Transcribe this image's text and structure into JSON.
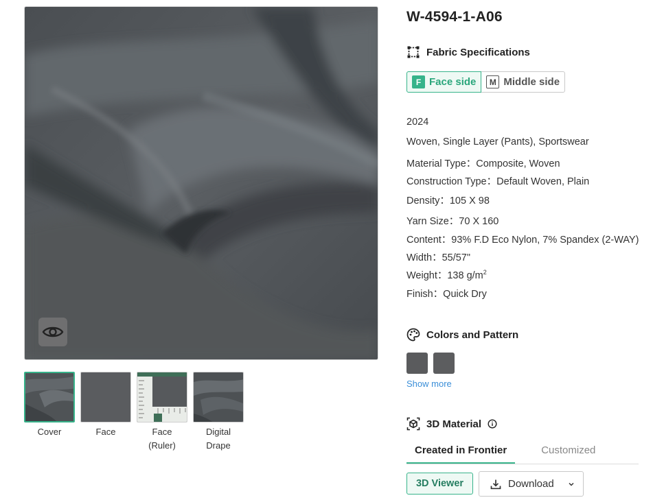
{
  "product": {
    "code": "W-4594-1-A06"
  },
  "gallery": {
    "thumbnails": [
      {
        "label_line1": "Cover",
        "label_line2": ""
      },
      {
        "label_line1": "Face",
        "label_line2": ""
      },
      {
        "label_line1": "Face",
        "label_line2": "(Ruler)"
      },
      {
        "label_line1": "Digital",
        "label_line2": "Drape"
      }
    ],
    "active_index": 0
  },
  "specs": {
    "heading": "Fabric Specifications",
    "sides": [
      {
        "badge": "F",
        "label": "Face side",
        "active": true
      },
      {
        "badge": "M",
        "label": "Middle side",
        "active": false
      }
    ],
    "year": "2024",
    "usage": "Woven, Single Layer (Pants), Sportswear",
    "material_type": "Material Type：Composite, Woven",
    "construction_type": "Construction Type：Default Woven, Plain",
    "density": "Density：105 X 98",
    "yarn_size": "Yarn Size：70 X 160",
    "content": "Content：93% F.D Eco Nylon, 7% Spandex (2-WAY)",
    "width": "Width：55/57\"",
    "weight_prefix": "Weight：138 g/m",
    "weight_sup": "2",
    "finish": "Finish：Quick Dry"
  },
  "colors": {
    "heading": "Colors and Pattern",
    "swatches": [
      "#5a5b5d",
      "#5c5d5f"
    ],
    "show_more": "Show more"
  },
  "material3d": {
    "heading": "3D Material",
    "tabs": [
      "Created in Frontier",
      "Customized"
    ],
    "active_tab": 0,
    "viewer_label": "3D Viewer",
    "download_label": "Download"
  },
  "icons": {
    "eye": "eye-icon",
    "spec": "fabric-spec-icon",
    "palette": "palette-icon",
    "cube": "3d-cube-icon",
    "info": "info-icon",
    "download": "download-icon",
    "chevron": "chevron-down-icon"
  }
}
